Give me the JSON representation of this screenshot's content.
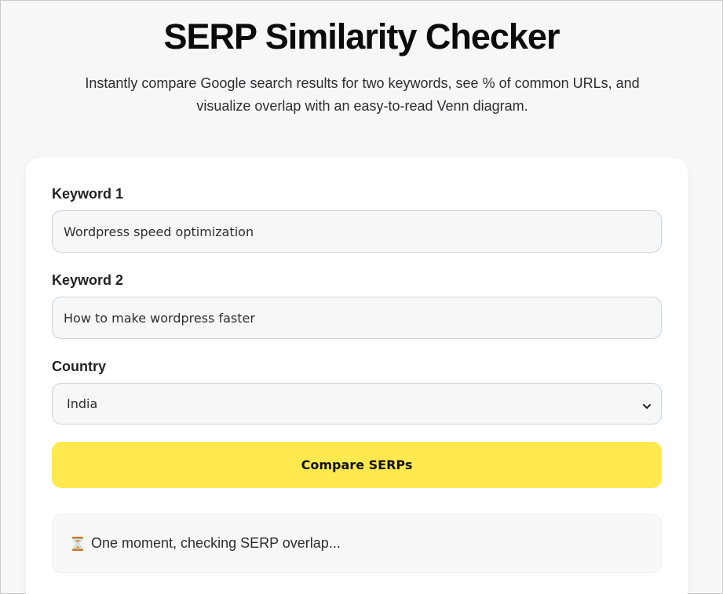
{
  "header": {
    "title": "SERP Similarity Checker",
    "subtitle": "Instantly compare Google search results for two keywords, see % of common URLs, and visualize overlap with an easy-to-read Venn diagram."
  },
  "form": {
    "keyword1": {
      "label": "Keyword 1",
      "value": "Wordpress speed optimization"
    },
    "keyword2": {
      "label": "Keyword 2",
      "value": "How to make wordpress faster"
    },
    "country": {
      "label": "Country",
      "selected": "India"
    },
    "submit_label": "Compare SERPs"
  },
  "status": {
    "icon": "hourglass-icon",
    "message": "One moment, checking SERP overlap..."
  },
  "colors": {
    "page_bg": "#f7f7f8",
    "button_bg": "#ffe94f",
    "hourglass": "#e39a2e"
  }
}
